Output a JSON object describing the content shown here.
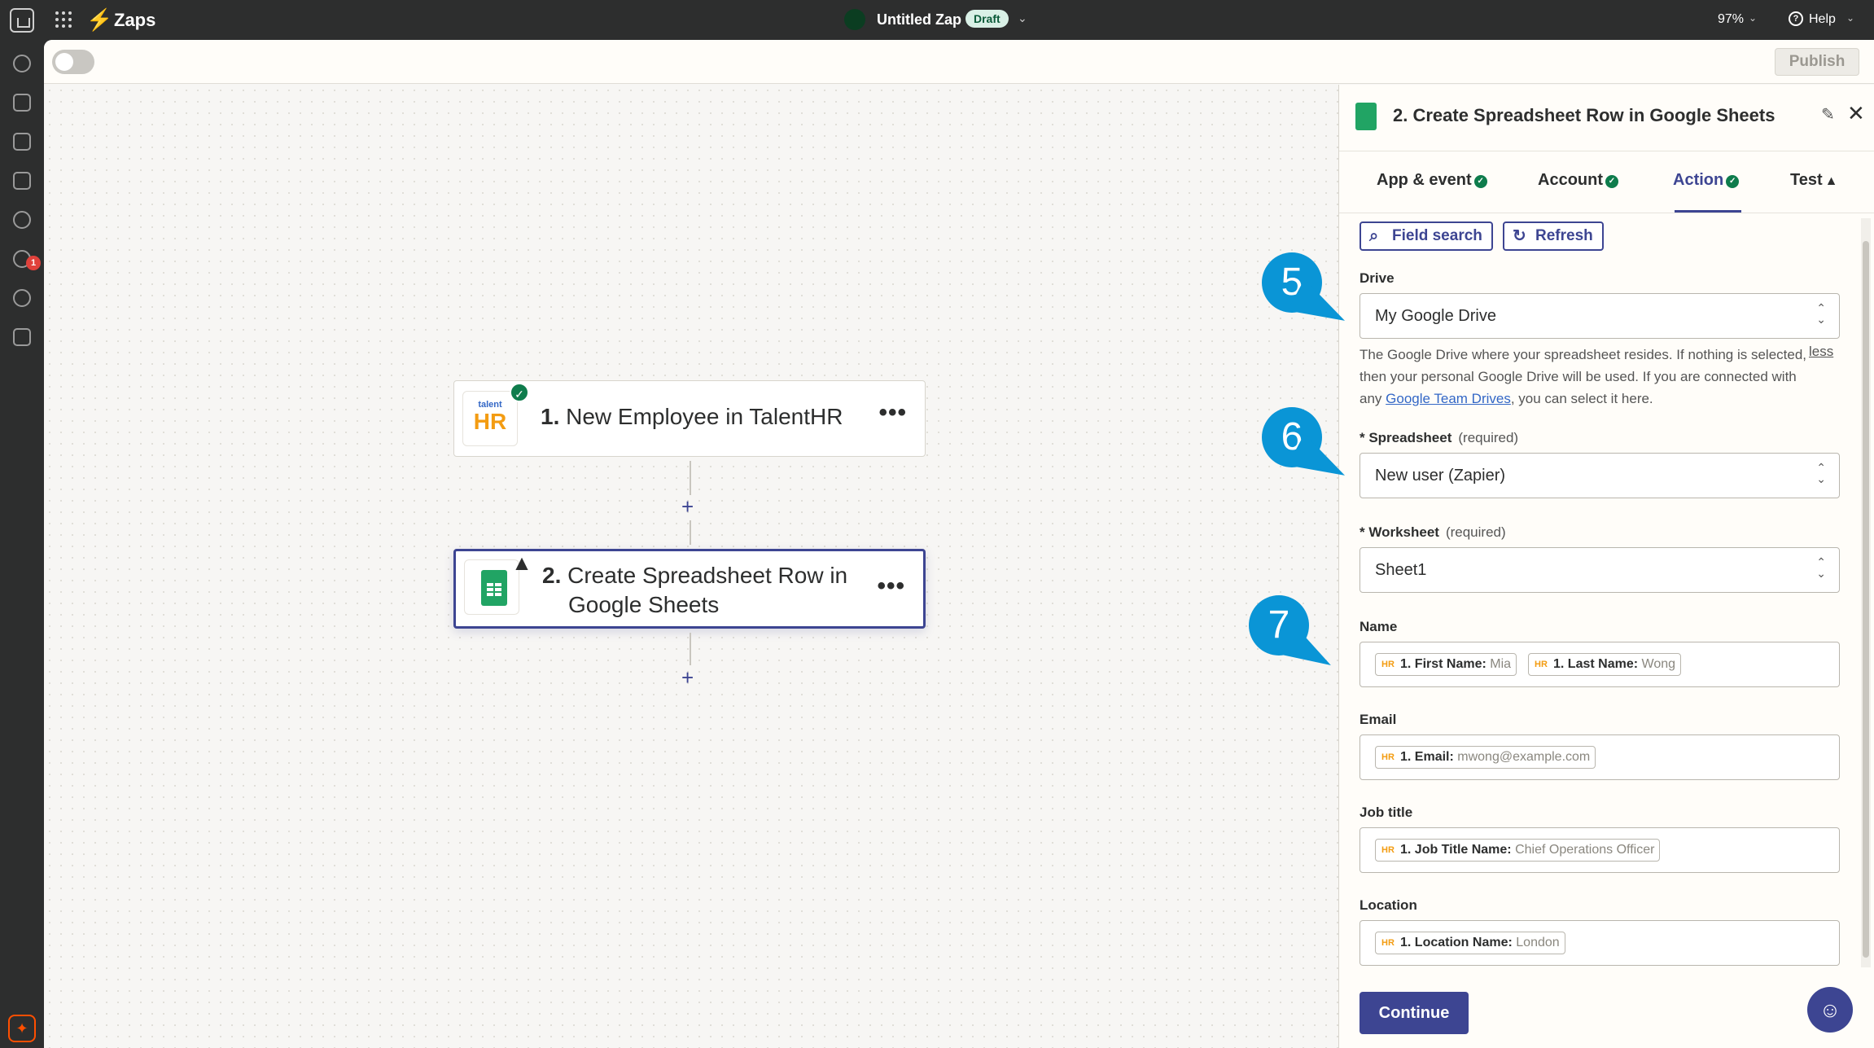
{
  "topbar": {
    "app_name": "Zaps",
    "zap_title": "Untitled Zap",
    "status_badge": "Draft",
    "zoom": "97%",
    "help": "Help"
  },
  "rail": {
    "notification_count": "1"
  },
  "toolbar": {
    "publish_label": "Publish"
  },
  "canvas": {
    "steps": [
      {
        "number": "1.",
        "title": "New Employee in TalentHR",
        "app": "TalentHR",
        "logo_top": "talent",
        "logo_bottom": "HR",
        "status": "complete"
      },
      {
        "number": "2.",
        "title_line1": "Create Spreadsheet Row in",
        "title_line2": "Google Sheets",
        "app": "Google Sheets",
        "status": "warning"
      }
    ],
    "add_step_symbol": "+"
  },
  "panel": {
    "title": "2. Create Spreadsheet Row in Google Sheets",
    "tabs": [
      {
        "label": "App & event",
        "state": "complete"
      },
      {
        "label": "Account",
        "state": "complete"
      },
      {
        "label": "Action",
        "state": "complete",
        "active": true
      },
      {
        "label": "Test",
        "state": "warning"
      }
    ],
    "field_search_label": "Field search",
    "refresh_label": "Refresh",
    "drive": {
      "label": "Drive",
      "value": "My Google Drive",
      "help_part1": "The Google Drive where your spreadsheet resides. If nothing is selected, then your personal Google Drive will be used. If you are connected with any ",
      "help_link": "Google Team Drives",
      "help_part2": ", you can select it here.",
      "less": "less"
    },
    "spreadsheet": {
      "label": "* Spreadsheet",
      "required": "(required)",
      "value": "New user (Zapier)"
    },
    "worksheet": {
      "label": "* Worksheet",
      "required": "(required)",
      "value": "Sheet1"
    },
    "name": {
      "label": "Name",
      "pills": [
        {
          "key": "1. First Name:",
          "value": "Mia"
        },
        {
          "key": "1. Last Name:",
          "value": "Wong"
        }
      ]
    },
    "email": {
      "label": "Email",
      "pills": [
        {
          "key": "1. Email:",
          "value": "mwong@example.com"
        }
      ]
    },
    "job_title": {
      "label": "Job title",
      "pills": [
        {
          "key": "1. Job Title Name:",
          "value": "Chief Operations Officer"
        }
      ]
    },
    "location": {
      "label": "Location",
      "pills": [
        {
          "key": "1. Location Name:",
          "value": "London"
        }
      ]
    },
    "continue_label": "Continue"
  },
  "callouts": [
    "5",
    "6",
    "7"
  ],
  "colors": {
    "brand_accent": "#3d4592",
    "zapier_orange": "#ff4f00",
    "success": "#0e7c4c",
    "callout_blue": "#0a95d6",
    "sheets_green": "#21a464"
  },
  "icons": [
    "home-icon",
    "apps-grid-icon",
    "bolt-icon",
    "help-icon",
    "google-sheets-icon",
    "talenthr-icon",
    "check-icon",
    "warning-icon",
    "more-icon",
    "edit-icon",
    "close-icon",
    "search-icon",
    "refresh-icon",
    "updown-chevron-icon",
    "assistant-icon"
  ]
}
